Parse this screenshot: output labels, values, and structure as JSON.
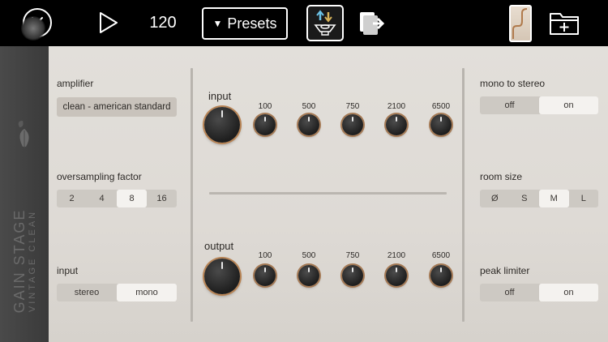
{
  "topbar": {
    "tempo": "120",
    "presets_label": "Presets",
    "icons": [
      "close-icon",
      "play-icon",
      "speaker-icon",
      "export-icon",
      "folder-add-icon"
    ]
  },
  "strip": {
    "title": "GAIN STAGE",
    "subtitle": "VINTAGE CLEAN"
  },
  "left": {
    "amplifier_label": "amplifier",
    "amplifier_value": "clean - american standard",
    "oversampling_label": "oversampling factor",
    "oversampling_options": [
      "2",
      "4",
      "8",
      "16"
    ],
    "oversampling_selected": "8",
    "input_label": "input",
    "input_options": [
      "stereo",
      "mono"
    ],
    "input_selected": "mono"
  },
  "center": {
    "input_title": "input",
    "output_title": "output",
    "freqs": [
      "100",
      "500",
      "750",
      "2100",
      "6500"
    ]
  },
  "right": {
    "mono_label": "mono to stereo",
    "mono_options": [
      "off",
      "on"
    ],
    "mono_selected": "on",
    "room_label": "room size",
    "room_options": [
      "Ø",
      "S",
      "M",
      "L"
    ],
    "room_selected": "M",
    "limiter_label": "peak limiter",
    "limiter_options": [
      "off",
      "on"
    ],
    "limiter_selected": "on"
  },
  "colors": {
    "panel": "#dedad5",
    "knob_ring": "#b88455",
    "topbar": "#000000"
  }
}
